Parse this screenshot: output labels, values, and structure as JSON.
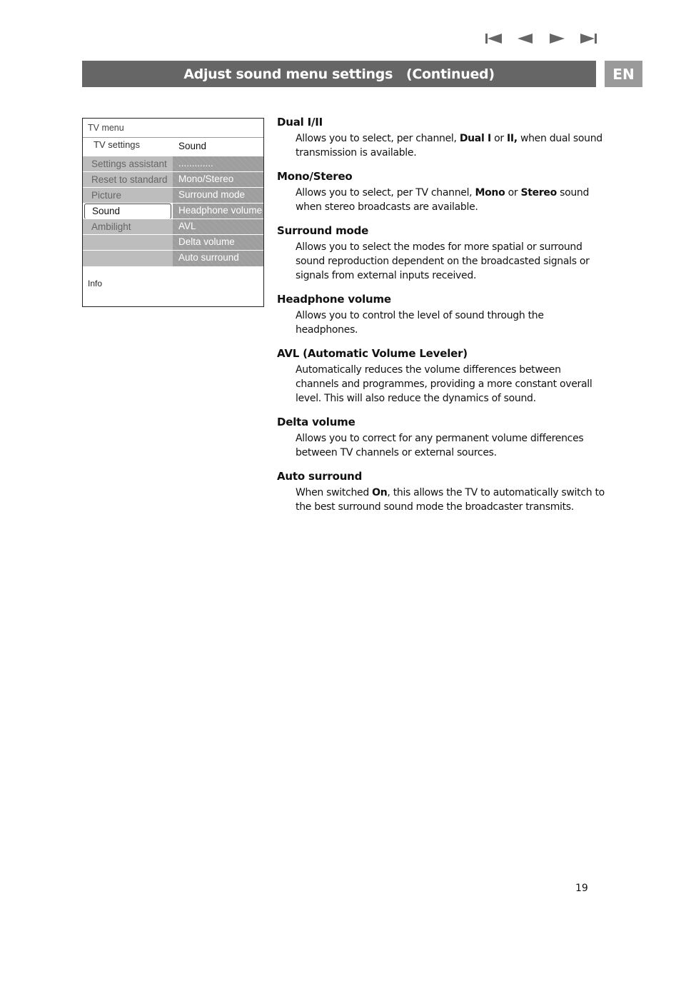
{
  "nav": {
    "buttons": [
      {
        "icon": "skip-to-start-icon",
        "label": "First page"
      },
      {
        "icon": "previous-icon",
        "label": "Previous page"
      },
      {
        "icon": "next-icon",
        "label": "Next page"
      },
      {
        "icon": "skip-to-end-icon",
        "label": "Last page"
      }
    ],
    "icon_color": "#666666"
  },
  "header": {
    "title": "Adjust sound menu settings   (Continued)",
    "bar_color": "#666666",
    "language": "EN",
    "language_color": "#9a9a9a"
  },
  "tv_menu": {
    "title": "TV menu",
    "submenu_left": "TV settings",
    "submenu_right": "Sound",
    "rows": [
      {
        "left": "Settings assistant",
        "right": "............."
      },
      {
        "left": "Reset to standard",
        "right": "Mono/Stereo"
      },
      {
        "left": "Picture",
        "right": "Surround mode"
      },
      {
        "left": "Sound",
        "right": "Headphone volume",
        "selected": true
      },
      {
        "left": "Ambilight",
        "right": "AVL"
      },
      {
        "left": "",
        "right": "Delta volume"
      },
      {
        "left": "",
        "right": "Auto surround"
      }
    ],
    "info_label": "Info"
  },
  "sections": [
    {
      "heading": "Dual I/II",
      "body": [
        {
          "t": "Allows you to select, per channel, "
        },
        {
          "t": "Dual I",
          "b": true
        },
        {
          "t": " or "
        },
        {
          "t": "II,",
          "b": true
        },
        {
          "t": " when dual sound transmission is available."
        }
      ]
    },
    {
      "heading": "Mono/Stereo",
      "body": [
        {
          "t": "Allows you to select, per TV channel, "
        },
        {
          "t": "Mono",
          "b": true
        },
        {
          "t": " or "
        },
        {
          "t": "Stereo",
          "b": true
        },
        {
          "t": " sound when stereo broadcasts are available."
        }
      ]
    },
    {
      "heading": "Surround mode",
      "body": [
        {
          "t": "Allows you to select the modes for more spatial or surround sound reproduction dependent on the broadcasted signals or signals from external inputs received."
        }
      ]
    },
    {
      "heading": "Headphone volume",
      "body": [
        {
          "t": "Allows you to control the level of sound through the headphones."
        }
      ]
    },
    {
      "heading": "AVL (Automatic Volume Leveler)",
      "body": [
        {
          "t": "Automatically reduces the volume differences between channels and programmes, providing a more constant overall level. This will also reduce the dynamics of sound."
        }
      ]
    },
    {
      "heading": "Delta volume",
      "body": [
        {
          "t": "Allows you to correct for any permanent volume differences between TV channels or external sources."
        }
      ]
    },
    {
      "heading": "Auto surround",
      "body": [
        {
          "t": "When switched "
        },
        {
          "t": "On",
          "b": true
        },
        {
          "t": ", this allows the TV to automatically switch to the best surround sound mode the broadcaster transmits."
        }
      ]
    }
  ],
  "footer": {
    "page_number": "19"
  }
}
